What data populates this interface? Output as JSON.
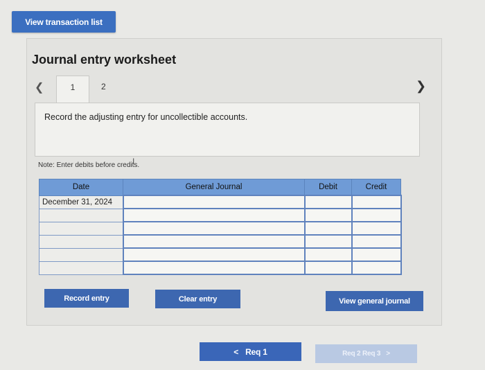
{
  "top_button": "View transaction list",
  "worksheet": {
    "title": "Journal entry worksheet",
    "tabs": [
      "1",
      "2"
    ],
    "instruction": "Record the adjusting entry for uncollectible accounts.",
    "note": "Note: Enter debits before credits."
  },
  "table": {
    "headers": [
      "Date",
      "General Journal",
      "Debit",
      "Credit"
    ],
    "rows": [
      {
        "date": "December 31, 2024",
        "account": "",
        "debit": "",
        "credit": ""
      },
      {
        "date": "",
        "account": "",
        "debit": "",
        "credit": ""
      },
      {
        "date": "",
        "account": "",
        "debit": "",
        "credit": ""
      },
      {
        "date": "",
        "account": "",
        "debit": "",
        "credit": ""
      },
      {
        "date": "",
        "account": "",
        "debit": "",
        "credit": ""
      },
      {
        "date": "",
        "account": "",
        "debit": "",
        "credit": ""
      }
    ]
  },
  "buttons": {
    "record": "Record entry",
    "clear": "Clear entry",
    "view_journal": "View general journal"
  },
  "pager": {
    "prev_label": "Req 1",
    "next_label": "Req 2 Req 3"
  }
}
